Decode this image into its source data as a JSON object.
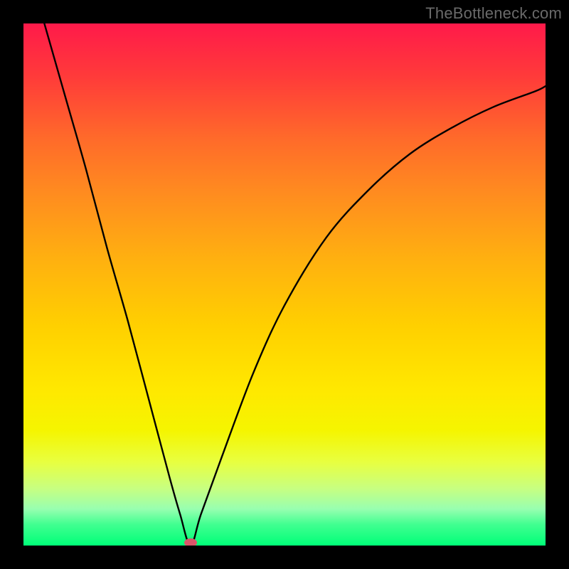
{
  "watermark": "TheBottleneck.com",
  "chart_data": {
    "type": "line",
    "title": "",
    "xlabel": "",
    "ylabel": "",
    "xlim": [
      0,
      1
    ],
    "ylim": [
      0,
      1
    ],
    "gradient_colors_top_to_bottom": [
      "#ff1a4a",
      "#ff6a2a",
      "#ffd000",
      "#f5f500",
      "#00ff78"
    ],
    "marker": {
      "x": 0.32,
      "y": 0.0,
      "color": "#d9556a"
    },
    "series": [
      {
        "name": "curve",
        "x": [
          0.04,
          0.08,
          0.12,
          0.16,
          0.2,
          0.24,
          0.28,
          0.3,
          0.32,
          0.34,
          0.38,
          0.44,
          0.5,
          0.58,
          0.66,
          0.74,
          0.82,
          0.9,
          0.98,
          1.0
        ],
        "y": [
          1.0,
          0.86,
          0.72,
          0.57,
          0.43,
          0.28,
          0.13,
          0.06,
          0.0,
          0.06,
          0.17,
          0.33,
          0.46,
          0.59,
          0.68,
          0.75,
          0.8,
          0.84,
          0.87,
          0.88
        ]
      }
    ]
  }
}
